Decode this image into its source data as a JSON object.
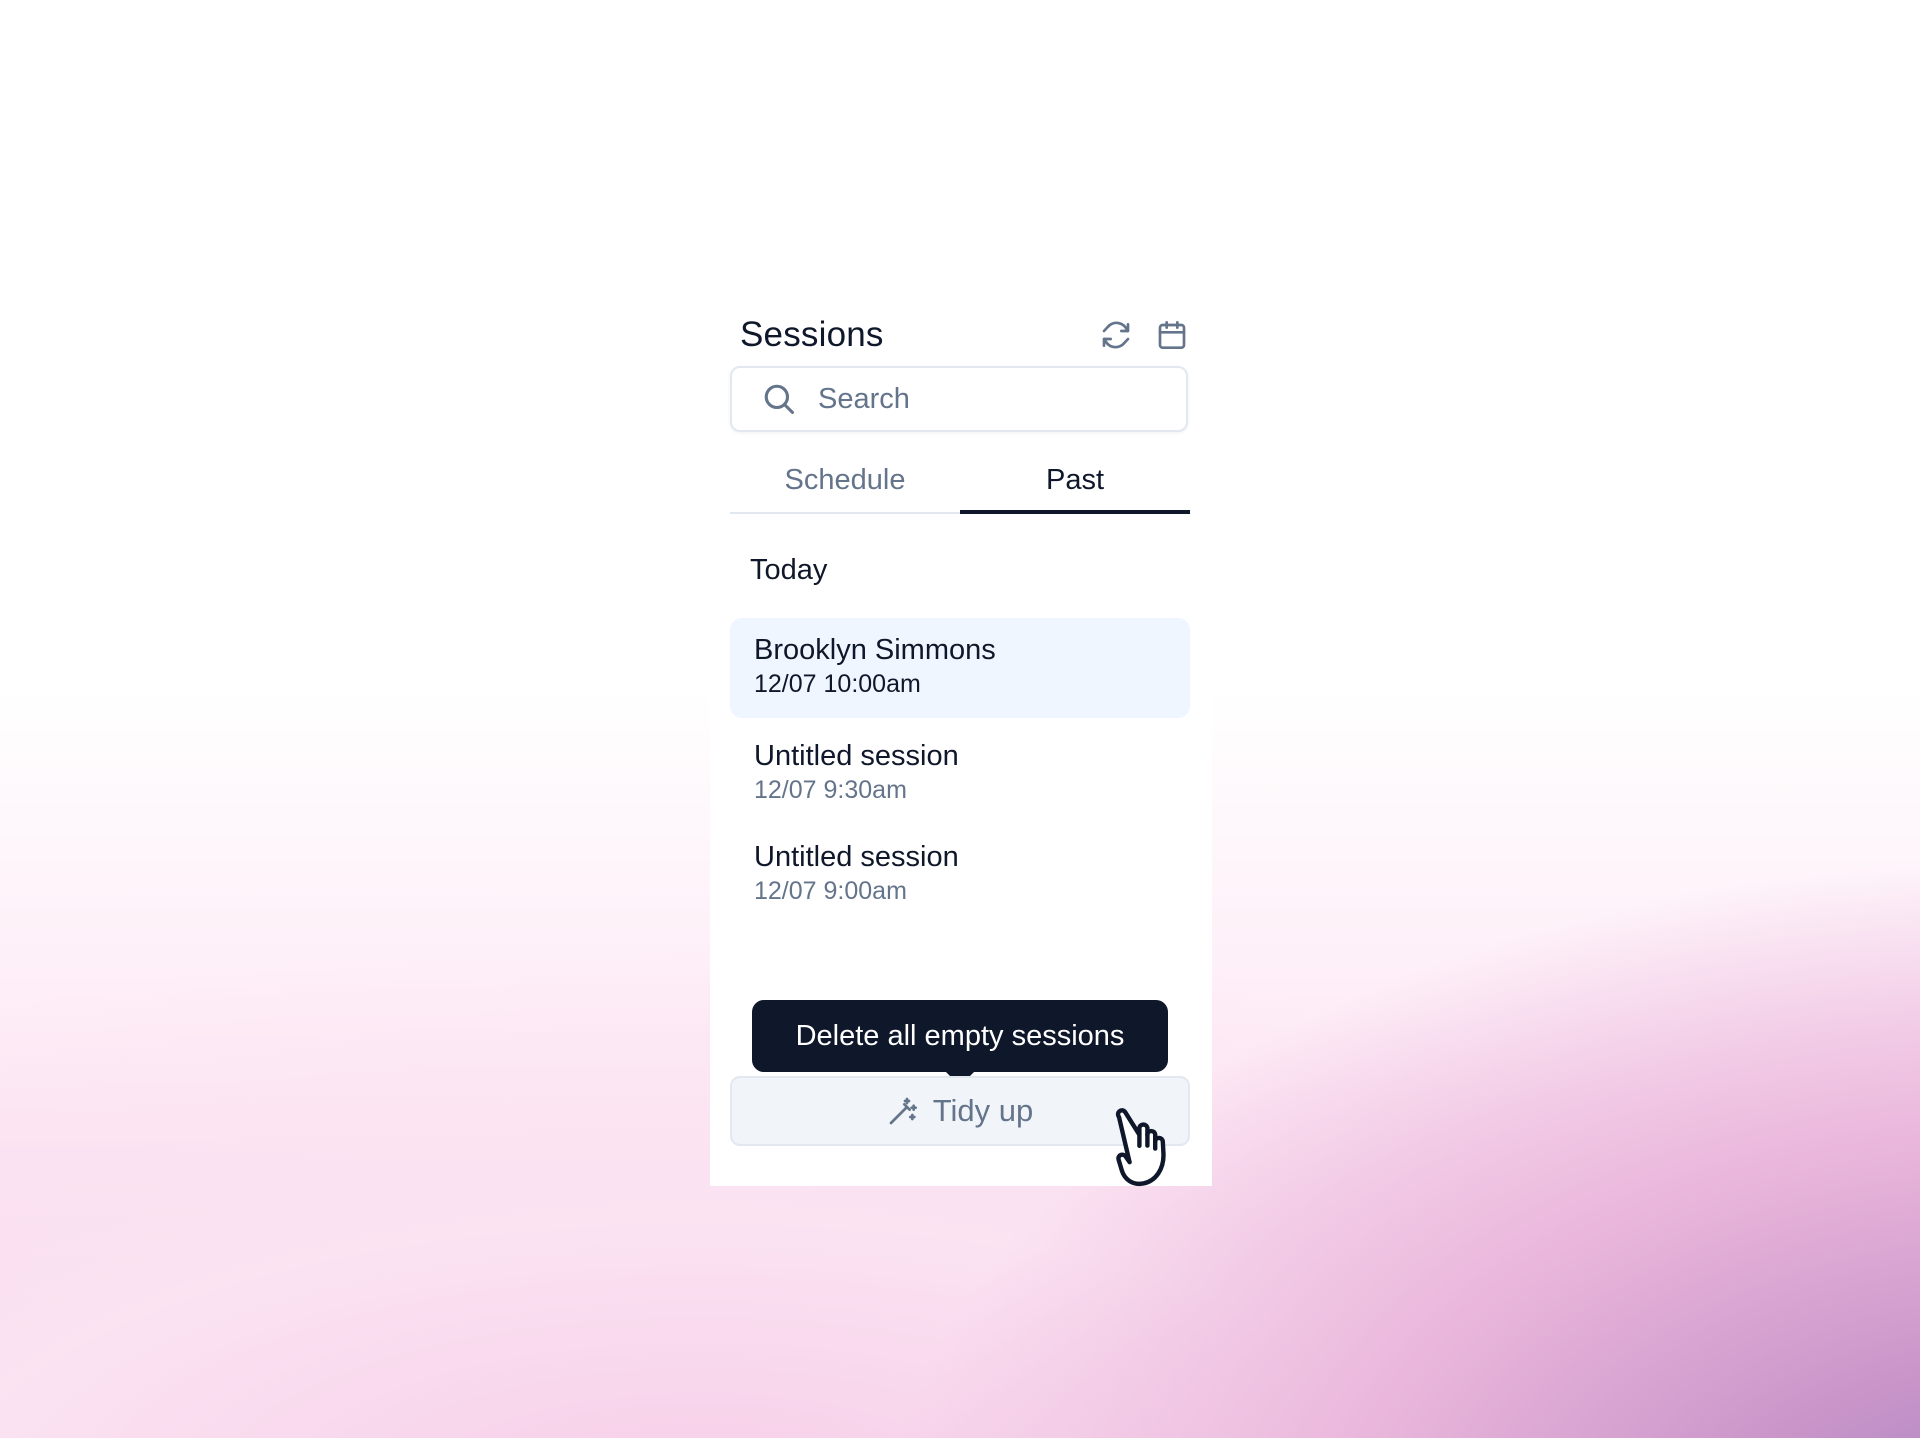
{
  "panel": {
    "title": "Sessions",
    "header_icons": [
      "refresh-icon",
      "calendar-icon"
    ]
  },
  "search": {
    "placeholder": "Search",
    "value": "",
    "icon": "search-icon"
  },
  "tabs": [
    {
      "label": "Schedule",
      "active": false
    },
    {
      "label": "Past",
      "active": true
    }
  ],
  "sections": [
    {
      "label": "Today",
      "sessions": [
        {
          "name": "Brooklyn Simmons",
          "time": "12/07 10:00am",
          "selected": true
        },
        {
          "name": "Untitled session",
          "time": "12/07 9:30am",
          "selected": false
        },
        {
          "name": "Untitled session",
          "time": "12/07 9:00am",
          "selected": false
        }
      ]
    }
  ],
  "tooltip": {
    "text": "Delete all empty sessions"
  },
  "tidy_button": {
    "label": "Tidy up",
    "icon": "magic-wand-icon"
  },
  "colors": {
    "text_primary": "#0f172a",
    "text_muted": "#64748b",
    "selected_bg": "#eff6ff",
    "tooltip_bg": "#0f172a",
    "button_bg": "#f1f5f9",
    "border": "#e2e8f0"
  }
}
